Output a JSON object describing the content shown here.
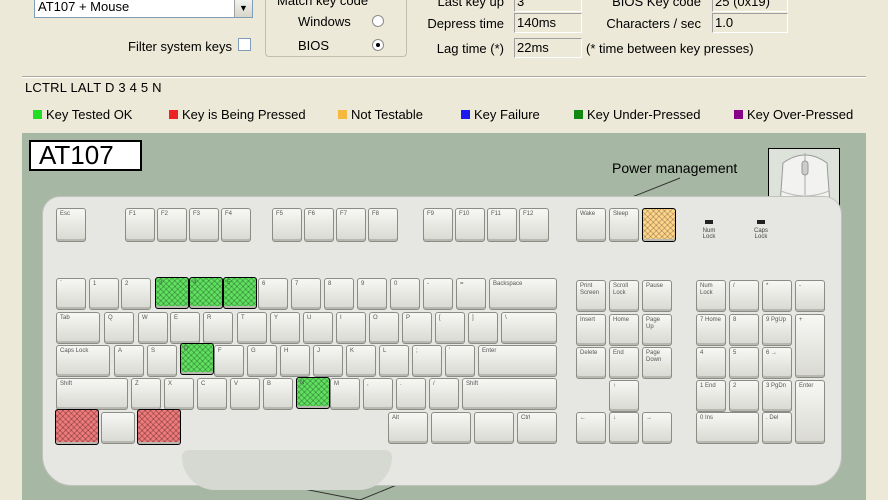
{
  "config": {
    "keyboard_select": "AT107 + Mouse",
    "filter_label": "Filter system keys",
    "match_title": "Match key code",
    "windows_label": "Windows",
    "bios_label": "BIOS"
  },
  "stats": {
    "last_key_up_label": "Last key up",
    "last_key_up_value": "3",
    "depress_label": "Depress time",
    "depress_value": "140ms",
    "lag_label": "Lag time (*)",
    "lag_value": "22ms",
    "bios_code_label": "BIOS Key code",
    "bios_code_value": "25 (0x19)",
    "cps_label": "Characters / sec",
    "cps_value": "1.0",
    "lag_note": "(* time between key presses)"
  },
  "pressed_keys": "LCTRL LALT D 3 4 5 N",
  "legend": [
    {
      "label": "Key Tested OK",
      "color": "#22dd22"
    },
    {
      "label": "Key is Being Pressed",
      "color": "#ee2222"
    },
    {
      "label": "Not Testable",
      "color": "#f7b93d"
    },
    {
      "label": "Key Failure",
      "color": "#1a1aee"
    },
    {
      "label": "Key Under-Pressed",
      "color": "#118811"
    },
    {
      "label": "Key Over-Pressed",
      "color": "#880088"
    }
  ],
  "keyboard": {
    "model": "AT107",
    "power_label": "Power management",
    "fn_keys": [
      "Esc",
      "F1",
      "F2",
      "F3",
      "F4",
      "F5",
      "F6",
      "F7",
      "F8",
      "F9",
      "F10",
      "F11",
      "F12"
    ],
    "power_keys": [
      "Wake",
      "Sleep",
      ""
    ],
    "lamps": [
      "Num Lock",
      "Caps Lock"
    ],
    "row_num": [
      "`",
      "1",
      "2",
      "3",
      "4",
      "5",
      "6",
      "7",
      "8",
      "9",
      "0",
      "-",
      "=",
      "Backspace"
    ],
    "row_q": [
      "Tab",
      "Q",
      "W",
      "E",
      "R",
      "T",
      "Y",
      "U",
      "I",
      "O",
      "P",
      "[",
      "]",
      "\\"
    ],
    "row_a": [
      "Caps Lock",
      "A",
      "S",
      "D",
      "F",
      "G",
      "H",
      "J",
      "K",
      "L",
      ";",
      "'",
      "Enter"
    ],
    "row_z": [
      "Shift",
      "Z",
      "X",
      "C",
      "V",
      "B",
      "N",
      "M",
      ",",
      ".",
      "/",
      "Shift"
    ],
    "row_ctrl": [
      "",
      "",
      "",
      "Alt",
      "",
      "",
      "Ctrl"
    ],
    "nav": [
      "Print Screen",
      "Scroll Lock",
      "Pause",
      "Insert",
      "Home",
      "Page Up",
      "Delete",
      "End",
      "Page Down"
    ],
    "arrows": [
      "↑",
      "←",
      "↓",
      "→"
    ],
    "numpad": [
      "Num Lock",
      "/",
      "*",
      "-",
      "7 Home",
      "8",
      "9 PgUp",
      "+",
      "4",
      "5",
      "6 →",
      "1 End",
      "2",
      "3 PgDn",
      "Enter",
      "0 Ins",
      ". Del"
    ]
  }
}
